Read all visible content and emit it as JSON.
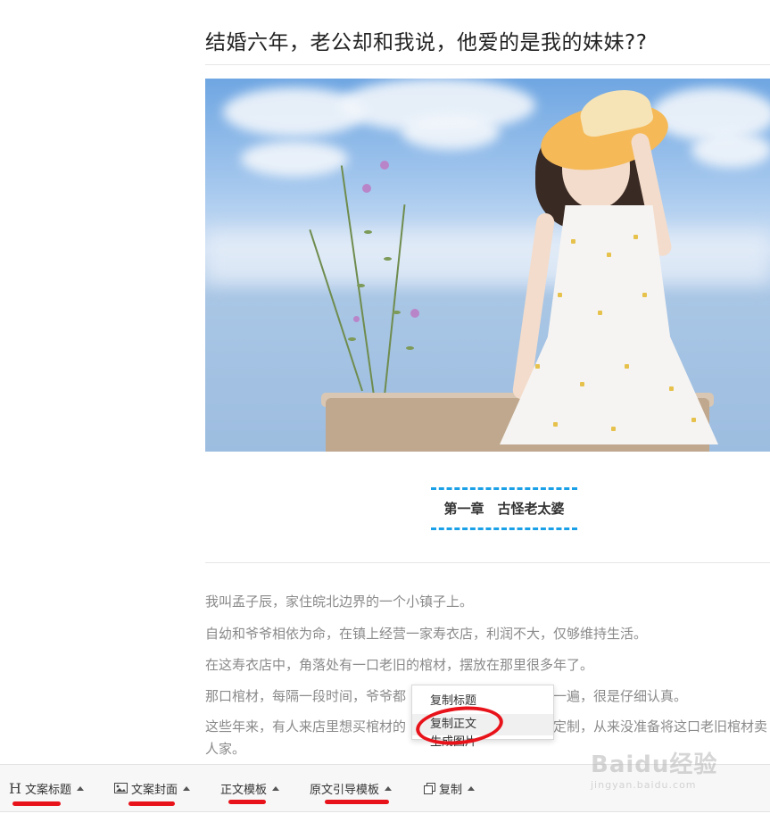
{
  "article": {
    "title": "结婚六年，老公却和我说，他爱的是我的妹妹??",
    "chapter": "第一章　古怪老太婆",
    "paragraphs": [
      "我叫孟子辰，家住皖北边界的一个小镇子上。",
      "自幼和爷爷相依为命，在镇上经营一家寿衣店，利润不大，仅够维持生活。",
      "在这寿衣店中，角落处有一口老旧的棺材，摆放在那里很多年了。",
      "那口棺材，每隔一段时间，爷爷都",
      "这些年来，有人来店里想买棺材的",
      "人家。"
    ],
    "paragraph_tails": {
      "line4": "一遍，很是仔细认真。",
      "line5": "定制，从来没准备将这口老旧棺材卖"
    }
  },
  "context_menu": {
    "items": [
      "复制标题",
      "复制正文",
      "生成图片"
    ],
    "highlighted_index": 1
  },
  "toolbar": {
    "items": [
      {
        "label": "文案标题",
        "icon": "heading-icon"
      },
      {
        "label": "文案封面",
        "icon": "image-icon"
      },
      {
        "label": "正文模板",
        "icon": "none"
      },
      {
        "label": "原文引导模板",
        "icon": "none"
      },
      {
        "label": "复制",
        "icon": "copy-icon"
      }
    ]
  },
  "watermark": {
    "brand": "Baidu经验",
    "url": "jingyan.baidu.com"
  },
  "colors": {
    "accent": "#1aa0e6",
    "annotation_red": "#e8131a"
  }
}
